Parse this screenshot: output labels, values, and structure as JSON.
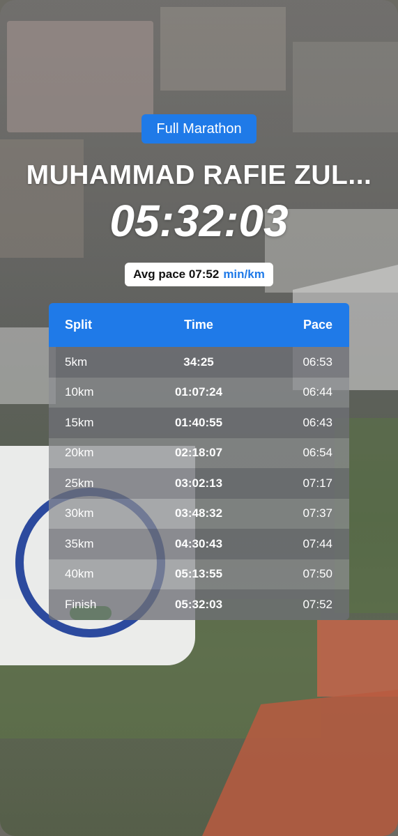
{
  "event": {
    "category": "Full Marathon"
  },
  "runner": {
    "name": "MUHAMMAD RAFIE ZUL..."
  },
  "result": {
    "total_time": "05:32:03",
    "avg_pace_label": "Avg pace 07:52",
    "avg_pace_unit": "min/km"
  },
  "splits": {
    "headers": {
      "split": "Split",
      "time": "Time",
      "pace": "Pace"
    },
    "rows": [
      {
        "split": "5km",
        "time": "34:25",
        "pace": "06:53"
      },
      {
        "split": "10km",
        "time": "01:07:24",
        "pace": "06:44"
      },
      {
        "split": "15km",
        "time": "01:40:55",
        "pace": "06:43"
      },
      {
        "split": "20km",
        "time": "02:18:07",
        "pace": "06:54"
      },
      {
        "split": "25km",
        "time": "03:02:13",
        "pace": "07:17"
      },
      {
        "split": "30km",
        "time": "03:48:32",
        "pace": "07:37"
      },
      {
        "split": "35km",
        "time": "04:30:43",
        "pace": "07:44"
      },
      {
        "split": "40km",
        "time": "05:13:55",
        "pace": "07:50"
      },
      {
        "split": "Finish",
        "time": "05:32:03",
        "pace": "07:52"
      }
    ]
  },
  "colors": {
    "accent": "#1f7ae8"
  }
}
